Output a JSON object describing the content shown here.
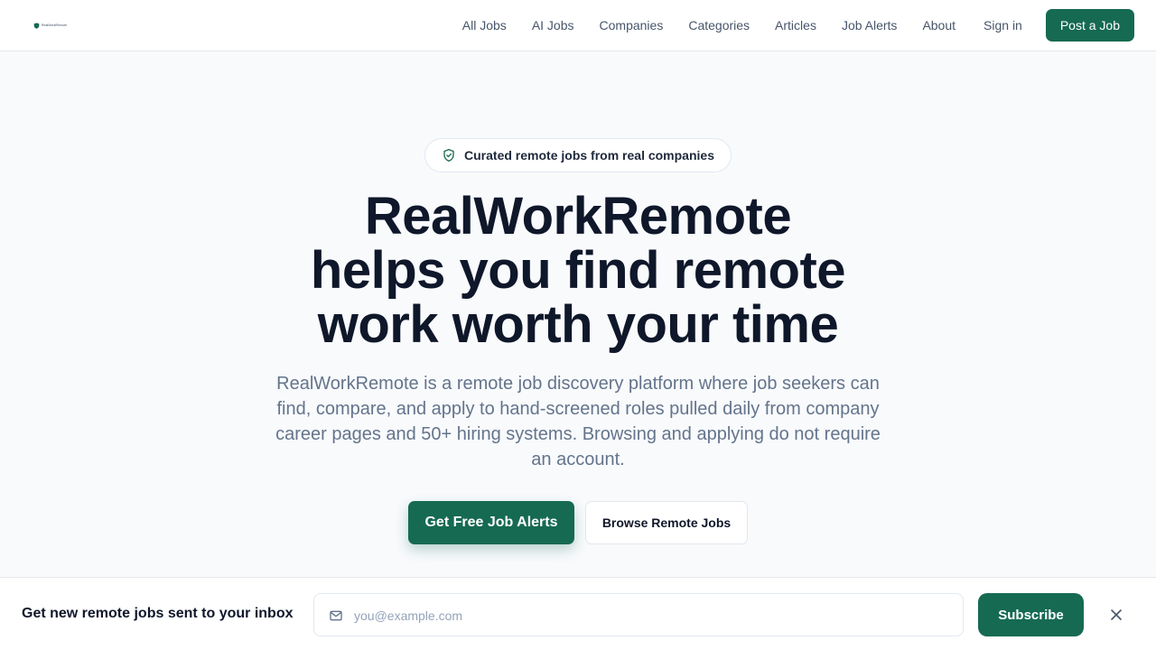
{
  "header": {
    "logo_text": "RealWorkRemote",
    "nav": [
      "All Jobs",
      "AI Jobs",
      "Companies",
      "Categories",
      "Articles",
      "Job Alerts",
      "About"
    ],
    "sign_in": "Sign in",
    "post_job": "Post a Job"
  },
  "hero": {
    "badge_icon": "shield-check-icon",
    "badge": "Curated remote jobs from real companies",
    "title_lines": [
      "RealWorkRemote",
      "helps you find remote",
      "work worth your time"
    ],
    "description": "RealWorkRemote is a remote job discovery platform where job seekers can find, compare, and apply to hand-screened roles pulled daily from company career pages and 50+ hiring systems. Browsing and applying do not require an account.",
    "cta_primary": "Get Free Job Alerts",
    "cta_secondary": "Browse Remote Jobs"
  },
  "bottom_bar": {
    "title": "Get new remote jobs sent to your inbox",
    "email_icon": "mail-icon",
    "email_placeholder": "you@example.com",
    "email_value": "",
    "subscribe": "Subscribe",
    "close_icon": "close-icon"
  },
  "colors": {
    "brand": "#166a52",
    "heading": "#0f172a",
    "muted": "#64748b",
    "background": "#f8fafc"
  }
}
